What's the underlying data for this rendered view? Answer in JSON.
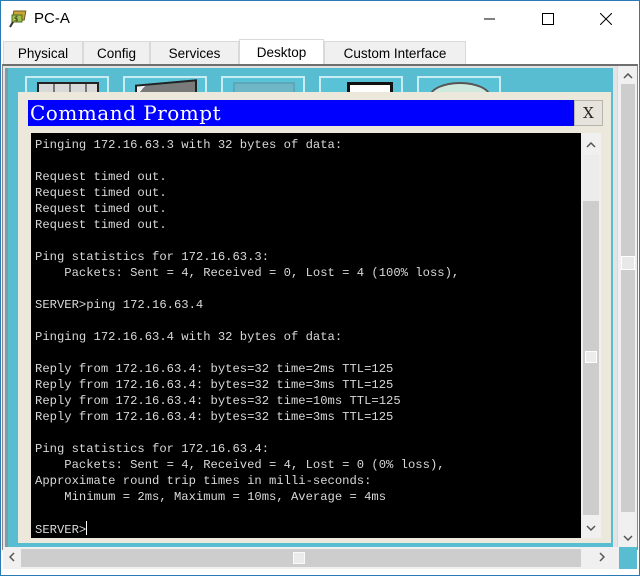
{
  "window": {
    "title": "PC-A",
    "icon": "packet-tracer-pc-icon",
    "controls": {
      "minimize": "minimize-icon",
      "maximize": "maximize-icon",
      "close": "close-icon"
    }
  },
  "tabs": [
    {
      "label": "Physical",
      "active": false
    },
    {
      "label": "Config",
      "active": false
    },
    {
      "label": "Services",
      "active": false
    },
    {
      "label": "Desktop",
      "active": true
    },
    {
      "label": "Custom Interface",
      "active": false
    }
  ],
  "desktop_icons": [
    {
      "icon": "ip-configuration-icon"
    },
    {
      "icon": "dial-up-icon"
    },
    {
      "icon": "terminal-icon"
    },
    {
      "icon": "command-prompt-icon"
    },
    {
      "icon": "web-browser-icon"
    }
  ],
  "command_prompt": {
    "title": "Command Prompt",
    "close_label": "X",
    "prompt": "SERVER>",
    "lines": [
      "Pinging 172.16.63.3 with 32 bytes of data:",
      "",
      "Request timed out.",
      "Request timed out.",
      "Request timed out.",
      "Request timed out.",
      "",
      "Ping statistics for 172.16.63.3:",
      "    Packets: Sent = 4, Received = 0, Lost = 4 (100% loss),",
      "",
      "SERVER>ping 172.16.63.4",
      "",
      "Pinging 172.16.63.4 with 32 bytes of data:",
      "",
      "Reply from 172.16.63.4: bytes=32 time=2ms TTL=125",
      "Reply from 172.16.63.4: bytes=32 time=3ms TTL=125",
      "Reply from 172.16.63.4: bytes=32 time=10ms TTL=125",
      "Reply from 172.16.63.4: bytes=32 time=3ms TTL=125",
      "",
      "Ping statistics for 172.16.63.4:",
      "    Packets: Sent = 4, Received = 4, Lost = 0 (0% loss),",
      "Approximate round trip times in milli-seconds:",
      "    Minimum = 2ms, Maximum = 10ms, Average = 4ms",
      ""
    ]
  },
  "colors": {
    "cmd_title_bg": "#0000ff",
    "terminal_bg": "#000000",
    "terminal_fg": "#d8d8d8",
    "desktop_bg": "#58bdd1"
  }
}
